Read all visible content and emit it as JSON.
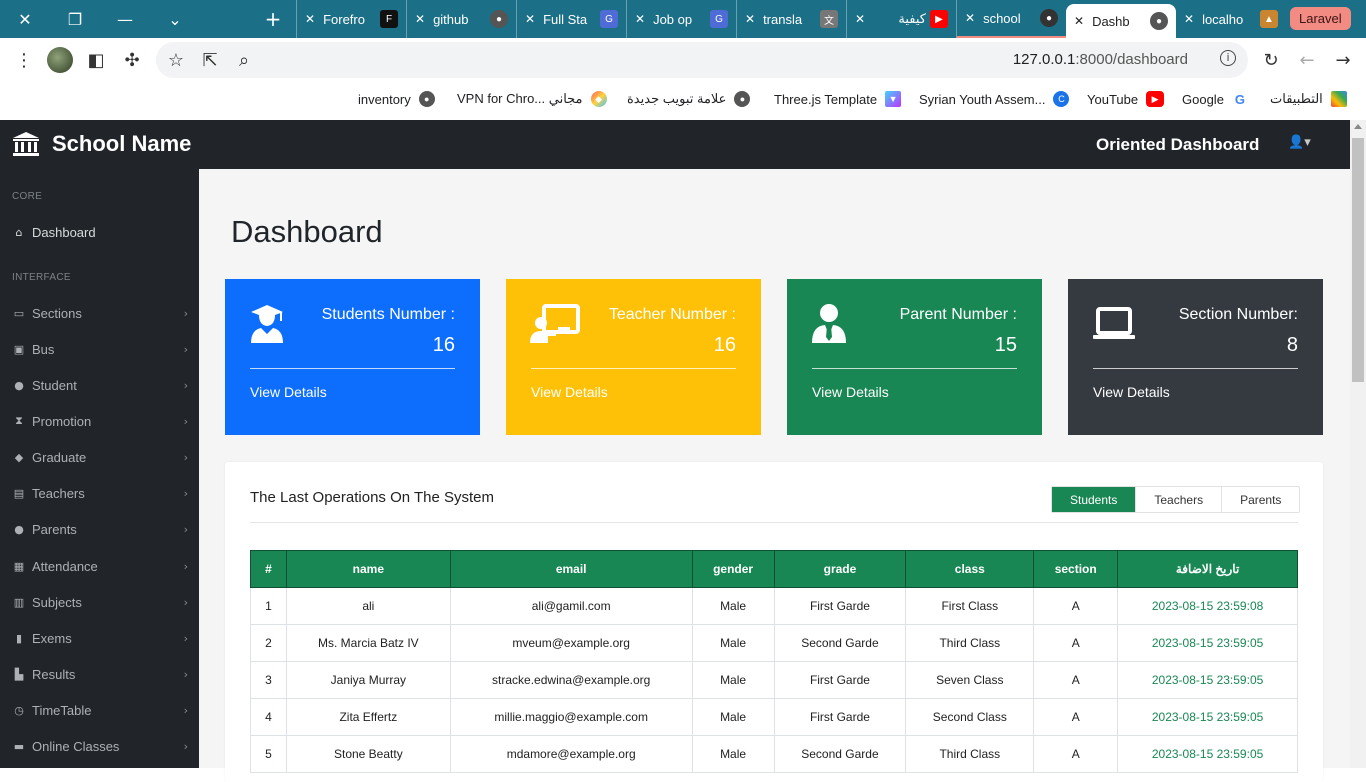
{
  "browser": {
    "new_tab_symbol": "+",
    "tabs": [
      {
        "title": "Forefro",
        "icon": "forefront-icon",
        "color": "#111111"
      },
      {
        "title": "github",
        "icon": "globe-icon",
        "color": "#555555"
      },
      {
        "title": "Full Sta",
        "icon": "chatgpt-icon",
        "color": "#4e6bd6"
      },
      {
        "title": "Job op",
        "icon": "chatgpt-icon",
        "color": "#4e6bd6"
      },
      {
        "title": "transla",
        "icon": "translate-icon",
        "color": "#777777"
      },
      {
        "title": "كيفية",
        "icon": "youtube-icon",
        "color": "#ff0000"
      },
      {
        "title": "school",
        "icon": "github-icon",
        "color": "#333333"
      },
      {
        "title": "Dashb",
        "icon": "globe-icon",
        "color": "#555555"
      },
      {
        "title": "localho",
        "icon": "tent-icon",
        "color": "#c9852f"
      }
    ],
    "group_label": "Laravel",
    "url_host": "127.0.0.1",
    "url_path": ":8000/dashboard",
    "bookmarks": [
      {
        "label": "التطبيقات",
        "icon": "apps-grid-icon"
      },
      {
        "label": "Google",
        "icon": "google-icon"
      },
      {
        "label": "YouTube",
        "icon": "youtube-icon"
      },
      {
        "label": "Syrian Youth Assem...",
        "icon": "c-icon"
      },
      {
        "label": "Three.js Template",
        "icon": "vite-icon"
      },
      {
        "label": "علامة تبويب جديدة",
        "icon": "globe-icon"
      },
      {
        "label": "VPN for Chro... مجاني",
        "icon": "vpn-icon"
      },
      {
        "label": "inventory",
        "icon": "globe-icon"
      }
    ]
  },
  "app": {
    "brand": "School Name",
    "header_title": "Oriented Dashboard",
    "user_caret": "▾"
  },
  "sidebar": {
    "core_heading": "CORE",
    "interface_heading": "INTERFACE",
    "dashboard": "Dashboard",
    "items": [
      {
        "label": "Sections",
        "icon": "tv-icon"
      },
      {
        "label": "Bus",
        "icon": "bus-icon"
      },
      {
        "label": "Student",
        "icon": "user-icon"
      },
      {
        "label": "Promotion",
        "icon": "hourglass-icon"
      },
      {
        "label": "Graduate",
        "icon": "graduation-cap-icon"
      },
      {
        "label": "Teachers",
        "icon": "chalkboard-teacher-icon"
      },
      {
        "label": "Parents",
        "icon": "user-tie-icon"
      },
      {
        "label": "Attendance",
        "icon": "calendar-icon"
      },
      {
        "label": "Subjects",
        "icon": "book-icon"
      },
      {
        "label": "Exems",
        "icon": "bookmark-icon"
      },
      {
        "label": "Results",
        "icon": "chart-icon"
      },
      {
        "label": "TimeTable",
        "icon": "clock-icon"
      },
      {
        "label": "Online Classes",
        "icon": "video-icon"
      }
    ]
  },
  "main": {
    "title": "Dashboard",
    "cards": [
      {
        "label": "Students Number :",
        "value": "16",
        "link": "View Details",
        "color": "#0d6efd",
        "icon": "user-graduate-icon"
      },
      {
        "label": "Teacher Number :",
        "value": "16",
        "link": "View Details",
        "color": "#ffc107",
        "icon": "chalkboard-teacher-icon"
      },
      {
        "label": "Parent Number :",
        "value": "15",
        "link": "View Details",
        "color": "#198754",
        "icon": "user-tie-icon"
      },
      {
        "label": "Section Number:",
        "value": "8",
        "link": "View Details",
        "color": "#343a40",
        "icon": "laptop-icon"
      }
    ],
    "operations": {
      "title": "The Last Operations On The System",
      "tabs": [
        "Students",
        "Teachers",
        "Parents"
      ],
      "active_tab": "Students",
      "columns": [
        "#",
        "name",
        "email",
        "gender",
        "grade",
        "class",
        "section",
        "تاريخ الاضافة"
      ],
      "rows": [
        [
          "1",
          "ali",
          "ali@gamil.com",
          "Male",
          "First Garde",
          "First Class",
          "A",
          "2023-08-15 23:59:08"
        ],
        [
          "2",
          "Ms. Marcia Batz IV",
          "mveum@example.org",
          "Male",
          "Second Garde",
          "Third Class",
          "A",
          "2023-08-15 23:59:05"
        ],
        [
          "3",
          "Janiya Murray",
          "stracke.edwina@example.org",
          "Male",
          "First Garde",
          "Seven Class",
          "A",
          "2023-08-15 23:59:05"
        ],
        [
          "4",
          "Zita Effertz",
          "millie.maggio@example.com",
          "Male",
          "First Garde",
          "Second Class",
          "A",
          "2023-08-15 23:59:05"
        ],
        [
          "5",
          "Stone Beatty",
          "mdamore@example.org",
          "Male",
          "Second Garde",
          "Third Class",
          "A",
          "2023-08-15 23:59:05"
        ]
      ]
    }
  }
}
